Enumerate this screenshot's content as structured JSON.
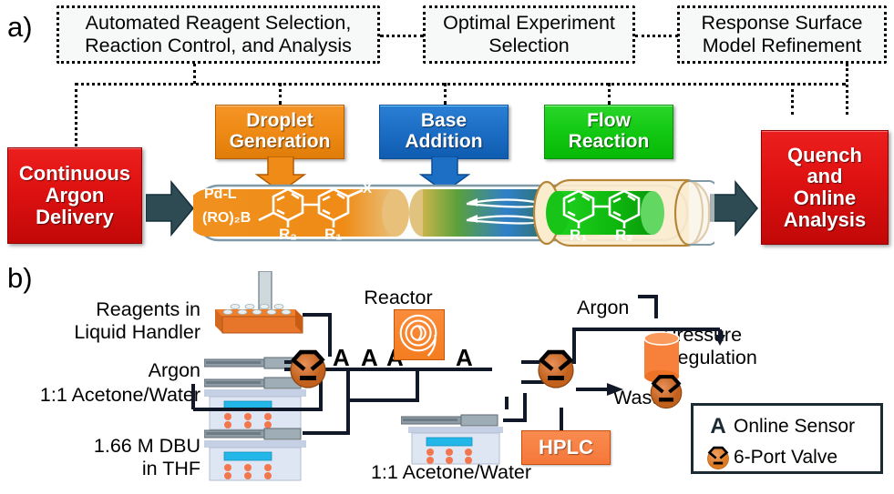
{
  "panels": {
    "a": "a)",
    "b": "b)"
  },
  "top_boxes": [
    {
      "id": "automated",
      "line1": "Automated Reagent Selection,",
      "line2": "Reaction Control, and Analysis"
    },
    {
      "id": "optimal",
      "line1": "Optimal Experiment",
      "line2": "Selection"
    },
    {
      "id": "response",
      "line1": "Response Surface",
      "line2": "Model Refinement"
    }
  ],
  "stages": [
    {
      "id": "continuous-argon-delivery",
      "lines": [
        "Continuous",
        "Argon",
        "Delivery"
      ],
      "color": "#e01212"
    },
    {
      "id": "droplet-generation",
      "lines": [
        "Droplet",
        "Generation"
      ],
      "color": "#ef8b16"
    },
    {
      "id": "base-addition",
      "lines": [
        "Base",
        "Addition"
      ],
      "color": "#1d6fc6"
    },
    {
      "id": "flow-reaction",
      "lines": [
        "Flow",
        "Reaction"
      ],
      "color": "#14ca14"
    },
    {
      "id": "quench-online-analysis",
      "lines": [
        "Quench",
        "and",
        "Online",
        "Analysis"
      ],
      "color": "#e01212"
    }
  ],
  "reactant_structure": {
    "catalyst": "Pd-L",
    "boron": "(RO)₂B",
    "sub_left": "R₂",
    "sub_right": "R₁",
    "halide": "X"
  },
  "product_structure": {
    "sub_left": "R₁",
    "sub_right": "R₂"
  },
  "flow_labels": {
    "reagents": "Reagents in\nLiquid Handler",
    "reagents_line1": "Reagents in",
    "reagents_line2": "Liquid Handler",
    "argon_in": "Argon",
    "acetone_water_1": "1:1 Acetone/Water",
    "dbu_line1": "1.66 M DBU",
    "dbu_line2": "in THF",
    "reactor": "Reactor",
    "argon_top": "Argon",
    "pressure_line1": "Pressure",
    "pressure_line2": "Regulation",
    "waste": "Waste",
    "hplc": "HPLC",
    "acetone_water_2": "1:1 Acetone/Water",
    "sensor_marks": [
      "A",
      "A",
      "A",
      "A"
    ]
  },
  "legend": {
    "rows": [
      {
        "icon": "A",
        "label": "Online Sensor"
      },
      {
        "icon": "valve",
        "label": "6-Port Valve"
      }
    ]
  },
  "colors": {
    "red": "#e01212",
    "orange": "#ef8b16",
    "blue": "#1d6fc6",
    "green": "#14ca14",
    "tube_outline": "#7f9aa6",
    "valve_body": "#d2691e",
    "pipe": "#111827"
  }
}
